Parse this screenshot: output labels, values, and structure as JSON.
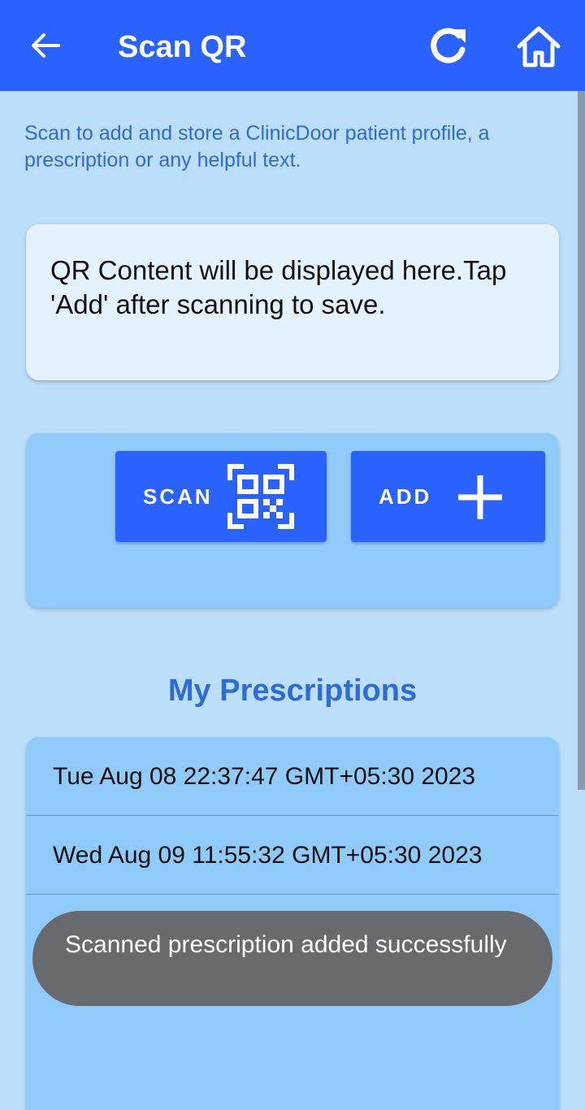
{
  "app_bar": {
    "title": "Scan QR",
    "back_icon": "arrow-left-icon",
    "refresh_icon": "refresh-icon",
    "home_icon": "home-icon",
    "color": "#2962ff"
  },
  "intro_text": "Scan to add and store a ClinicDoor patient profile, a prescription or any helpful text.",
  "qr_content": {
    "placeholder_text": "QR Content will be displayed here.Tap 'Add' after scanning to save."
  },
  "actions": {
    "scan_label": "SCAN",
    "scan_icon": "qr-code-icon",
    "add_label": "ADD",
    "add_icon": "plus-icon"
  },
  "prescriptions": {
    "title": "My Prescriptions",
    "items": [
      {
        "label": "Tue Aug 08 22:37:47 GMT+05:30 2023"
      },
      {
        "label": "Wed Aug 09 11:55:32 GMT+05:30 2023"
      }
    ]
  },
  "toast": {
    "message": "Scanned prescription added successfully"
  },
  "colors": {
    "page_background": "#bbdefb",
    "card_light": "#e3f2fd",
    "card_medium": "#90caf9",
    "accent_text": "#2f6bd6",
    "toast_background": "#676b6d"
  }
}
